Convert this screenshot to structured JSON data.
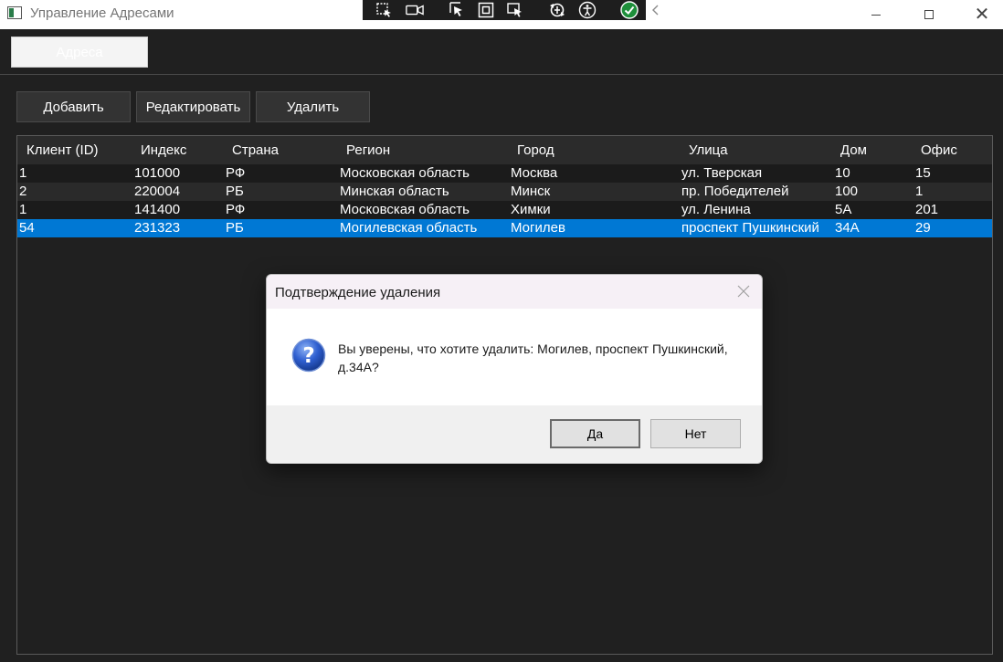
{
  "window": {
    "title": "Управление Адресами"
  },
  "debug_toolbar": {
    "icons": [
      "select-element-icon",
      "record-icon",
      "pointer-icon",
      "frame-icon",
      "snap-icon",
      "hot-reload-icon",
      "accessibility-icon",
      "check-icon",
      "collapse-icon"
    ]
  },
  "tabs": [
    {
      "label": "Адреса"
    }
  ],
  "toolbar": {
    "add_label": "Добавить",
    "edit_label": "Редактировать",
    "delete_label": "Удалить"
  },
  "grid": {
    "columns": [
      "Клиент (ID)",
      "Индекс",
      "Страна",
      "Регион",
      "Город",
      "Улица",
      "Дом",
      "Офис"
    ],
    "rows": [
      [
        "1",
        "101000",
        "РФ",
        "Московская область",
        "Москва",
        "ул. Тверская",
        "10",
        "15"
      ],
      [
        "2",
        "220004",
        "РБ",
        "Минская область",
        "Минск",
        "пр. Победителей",
        "100",
        "1"
      ],
      [
        "1",
        "141400",
        "РФ",
        "Московская область",
        "Химки",
        "ул. Ленина",
        "5А",
        "201"
      ],
      [
        "54",
        "231323",
        "РБ",
        "Могилевская область",
        "Могилев",
        "проспект Пушкинский",
        "34А",
        "29"
      ]
    ],
    "selected_row": 3
  },
  "dialog": {
    "title": "Подтверждение удаления",
    "message": "Вы уверены, что хотите удалить: Могилев, проспект Пушкинский, д.34А?",
    "yes_label": "Да",
    "no_label": "Нет",
    "icon": "question-icon"
  },
  "colors": {
    "background": "#202020",
    "selection": "#0078d4",
    "header": "#2b2b2b"
  }
}
